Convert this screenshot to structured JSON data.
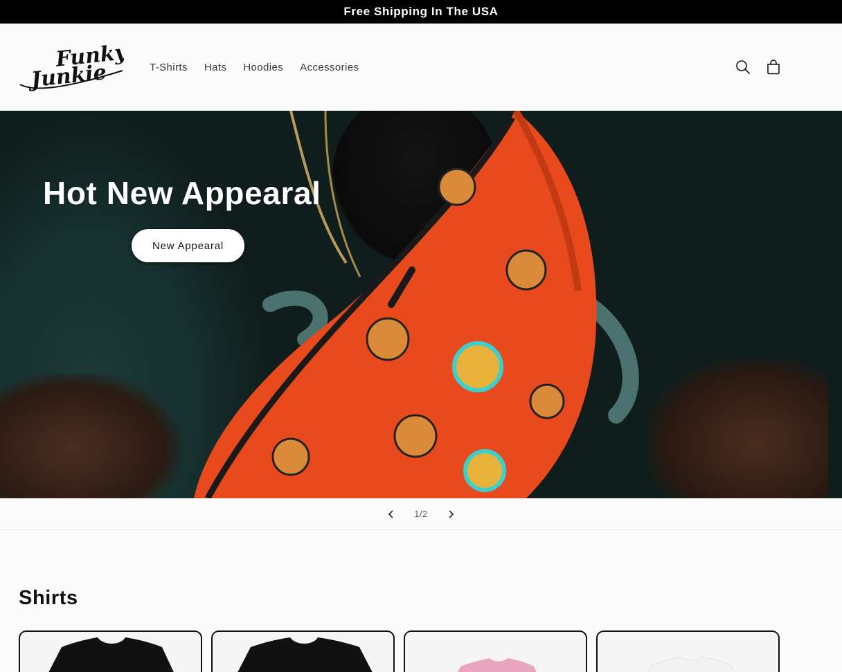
{
  "announcement": {
    "text": "Free Shipping In The USA"
  },
  "header": {
    "logo": {
      "line1": "Funky",
      "line2": "Junkie"
    },
    "nav": [
      {
        "label": "T-Shirts"
      },
      {
        "label": "Hats"
      },
      {
        "label": "Hoodies"
      },
      {
        "label": "Accessories"
      }
    ],
    "icons": {
      "search": "search-icon",
      "cart": "cart-icon"
    }
  },
  "hero": {
    "title": "Hot New Appearal",
    "button_label": "New Appearal"
  },
  "slider": {
    "counter": "1/2",
    "prev_icon": "chevron-left-icon",
    "next_icon": "chevron-right-icon"
  },
  "section": {
    "title": "Shirts",
    "products": [
      {
        "shirt_color": "#111111"
      },
      {
        "shirt_color": "#111111"
      },
      {
        "shirt_color": "#e7a6bd"
      },
      {
        "shirt_color": "#f2f2f2"
      }
    ]
  },
  "colors": {
    "announcement_bg": "#000000",
    "page_bg": "#fbfbfb",
    "hero_bag": "#e84a1e"
  }
}
